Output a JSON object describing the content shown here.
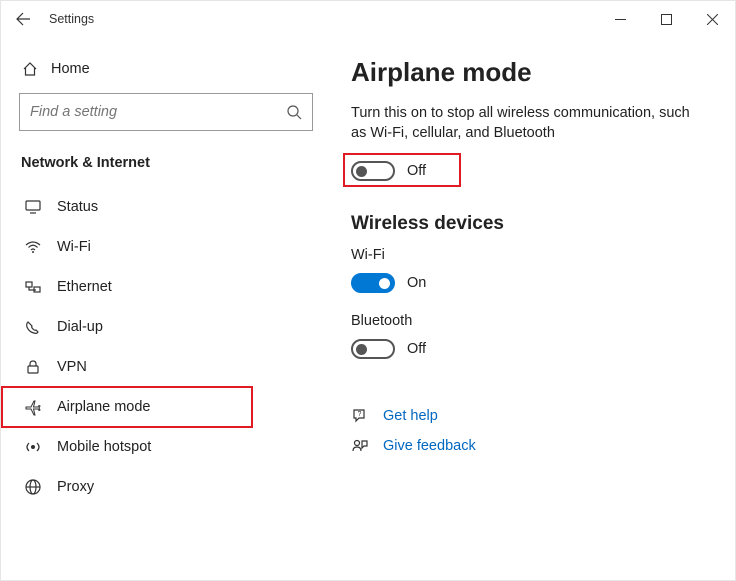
{
  "titlebar": {
    "title": "Settings"
  },
  "sidebar": {
    "home_label": "Home",
    "search_placeholder": "Find a setting",
    "section_header": "Network & Internet",
    "nav": [
      {
        "label": "Status"
      },
      {
        "label": "Wi-Fi"
      },
      {
        "label": "Ethernet"
      },
      {
        "label": "Dial-up"
      },
      {
        "label": "VPN"
      },
      {
        "label": "Airplane mode"
      },
      {
        "label": "Mobile hotspot"
      },
      {
        "label": "Proxy"
      }
    ]
  },
  "content": {
    "page_title": "Airplane mode",
    "desc": "Turn this on to stop all wireless communication, such as Wi-Fi, cellular, and Bluetooth",
    "airplane_toggle_state": "Off",
    "wireless_header": "Wireless devices",
    "wifi_label": "Wi-Fi",
    "wifi_state": "On",
    "bt_label": "Bluetooth",
    "bt_state": "Off",
    "help_label": "Get help",
    "feedback_label": "Give feedback"
  }
}
